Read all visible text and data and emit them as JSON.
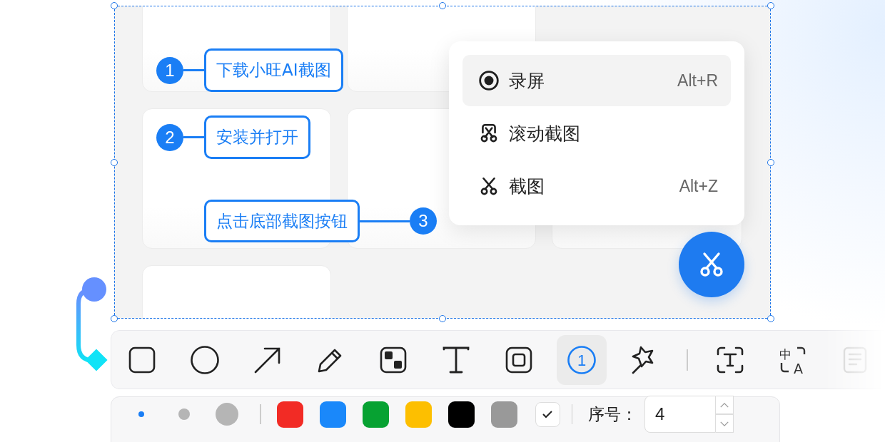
{
  "steps": [
    {
      "number": "1",
      "label": "下载小旺AI截图"
    },
    {
      "number": "2",
      "label": "安装并打开"
    },
    {
      "number": "3",
      "label": "点击底部截图按钮"
    }
  ],
  "menu": {
    "items": [
      {
        "label": "录屏",
        "shortcut": "Alt+R",
        "selected": true
      },
      {
        "label": "滚动截图",
        "selected": false
      },
      {
        "label": "截图",
        "shortcut": "Alt+Z",
        "selected": false
      }
    ]
  },
  "toolbar": {
    "tools": [
      {
        "selected": false
      },
      {
        "selected": false
      },
      {
        "selected": false
      },
      {
        "selected": false
      },
      {
        "selected": false
      },
      {
        "selected": false
      },
      {
        "selected": false
      },
      {
        "glyph": "1",
        "selected": true
      },
      {
        "selected": false
      }
    ],
    "extra_tools": [
      {
        "selected": false
      },
      {
        "glyph_top": "中",
        "glyph_bottom": "A",
        "selected": false
      },
      {
        "selected": false
      }
    ]
  },
  "options": {
    "sizes": [
      {
        "selected": true
      },
      {
        "selected": false
      },
      {
        "selected": false
      }
    ],
    "colors": [
      {
        "color": "#f22b25",
        "selected": false
      },
      {
        "color": "#1a88fa",
        "selected": false
      },
      {
        "color": "#07a232",
        "selected": false
      },
      {
        "color": "#fdbf00",
        "selected": false
      },
      {
        "color": "#000000",
        "selected": false
      },
      {
        "color": "#999999",
        "selected": false
      }
    ],
    "fill": {
      "checked": true
    },
    "number_label": "序号：",
    "number_value": "4"
  }
}
